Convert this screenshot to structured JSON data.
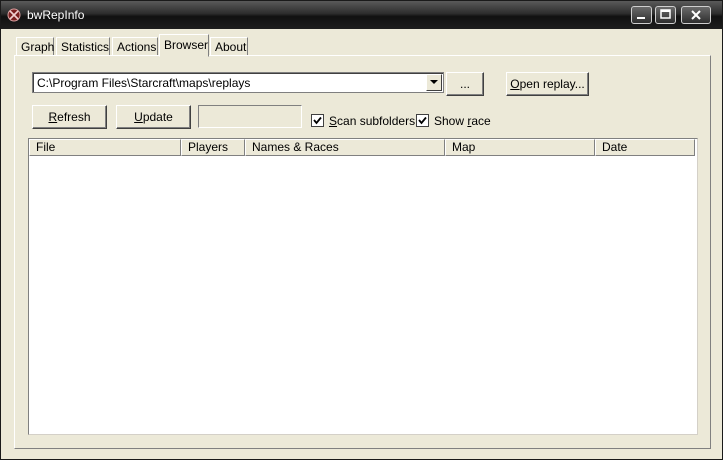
{
  "window": {
    "title": "bwRepInfo"
  },
  "tabs": [
    {
      "label": "Graph"
    },
    {
      "label": "Statistics"
    },
    {
      "label": "Actions"
    },
    {
      "label": "Browser",
      "active": true
    },
    {
      "label": "About"
    }
  ],
  "browser": {
    "path_value": "C:\\Program Files\\Starcraft\\maps\\replays",
    "browse_label": "...",
    "open_replay": {
      "accel": "O",
      "rest": "pen replay..."
    },
    "refresh": {
      "accel": "R",
      "rest": "efresh"
    },
    "update": {
      "accel": "U",
      "rest": "pdate"
    },
    "status_value": "",
    "scan_subfolders": {
      "accel": "S",
      "rest": "can subfolders",
      "checked": true
    },
    "show_race": {
      "pre": "Show ",
      "accel": "r",
      "rest": "ace",
      "checked": true
    }
  },
  "list": {
    "columns": [
      "File",
      "Players",
      "Names & Races",
      "Map",
      "Date"
    ],
    "rows": []
  }
}
